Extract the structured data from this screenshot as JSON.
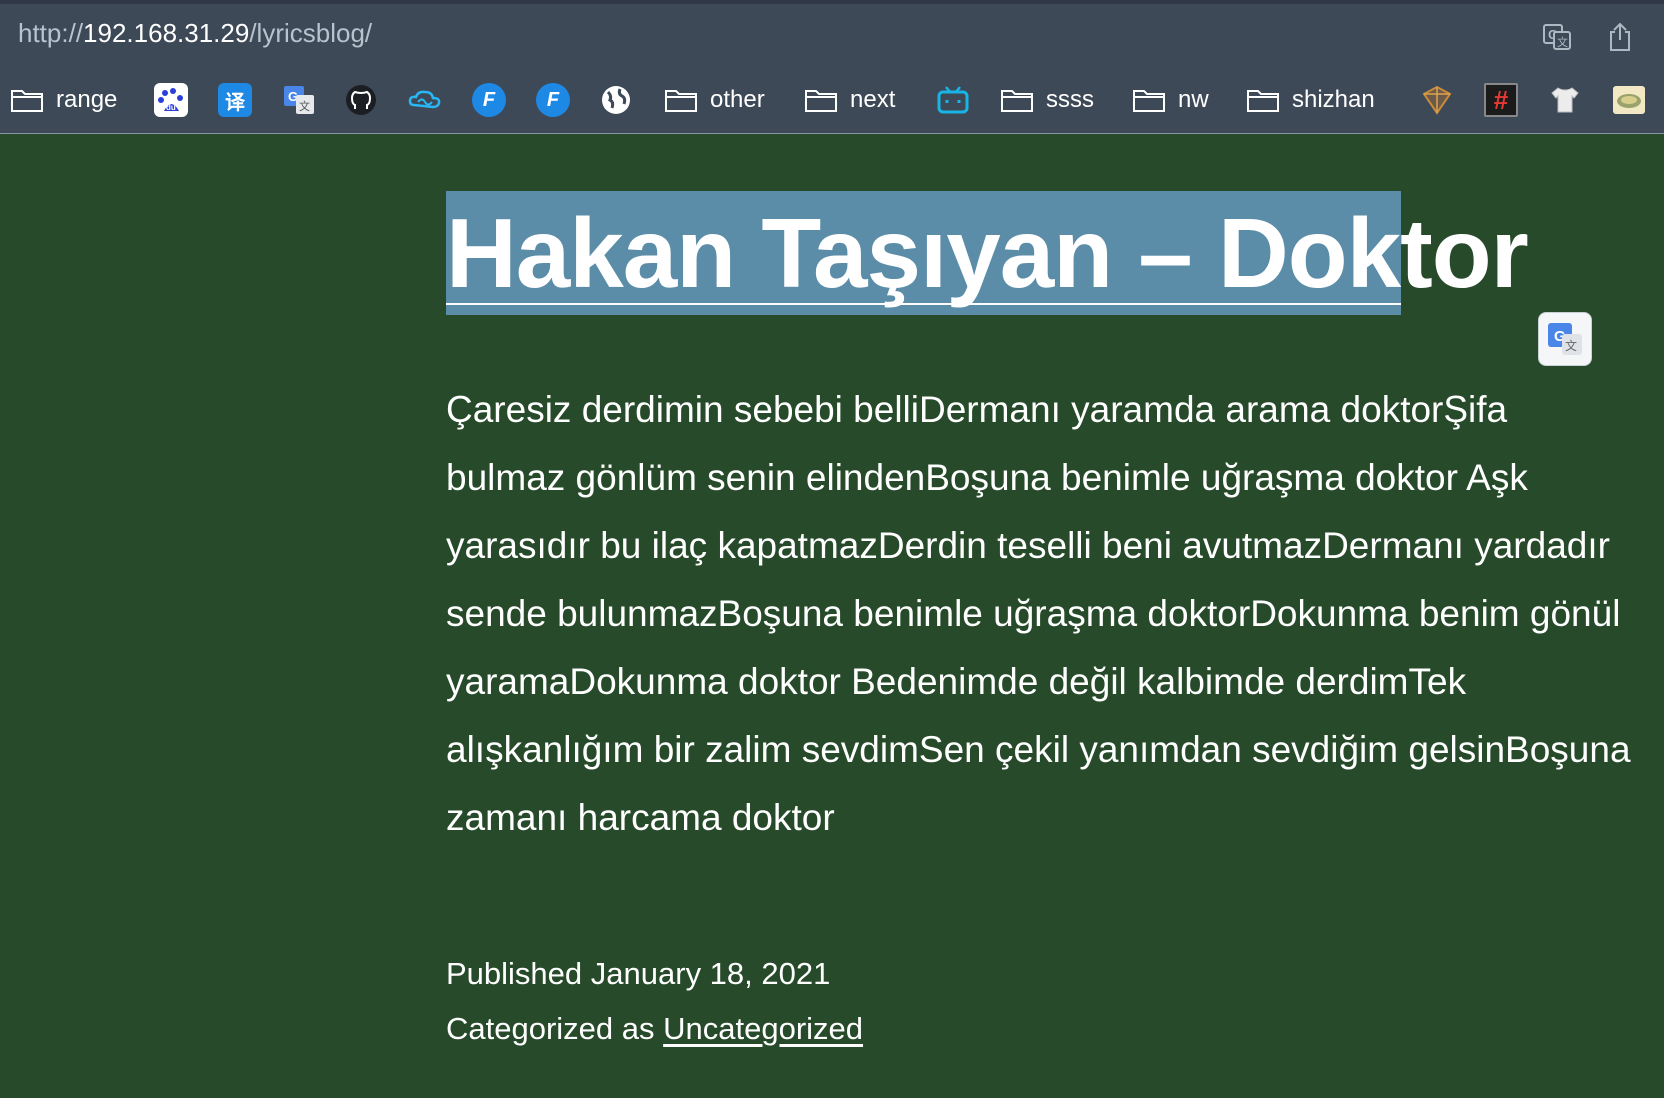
{
  "browser": {
    "url_scheme": "http://",
    "url_host": "192.168.31.29",
    "url_path": "/lyricsblog/",
    "translate_icon": "translate-icon",
    "share_icon": "share-icon"
  },
  "bookmarks": [
    {
      "type": "folder",
      "label": "range",
      "icon": "folder-icon"
    },
    {
      "type": "site",
      "icon": "baidu-icon",
      "glyph": "du"
    },
    {
      "type": "site",
      "icon": "translate-yi-icon",
      "glyph": "译"
    },
    {
      "type": "site",
      "icon": "google-translate-icon",
      "glyph": "G"
    },
    {
      "type": "site",
      "icon": "github-icon",
      "glyph": ""
    },
    {
      "type": "site",
      "icon": "cloud-icon",
      "glyph": "∞"
    },
    {
      "type": "site",
      "icon": "f-logo-icon",
      "glyph": "F"
    },
    {
      "type": "site",
      "icon": "f-logo-icon-2",
      "glyph": "F"
    },
    {
      "type": "site",
      "icon": "globe-icon",
      "glyph": ""
    },
    {
      "type": "folder",
      "label": "other",
      "icon": "folder-icon"
    },
    {
      "type": "folder",
      "label": "next",
      "icon": "folder-icon"
    },
    {
      "type": "site",
      "icon": "bilibili-icon",
      "glyph": ""
    },
    {
      "type": "folder",
      "label": "ssss",
      "icon": "folder-icon"
    },
    {
      "type": "folder",
      "label": "nw",
      "icon": "folder-icon"
    },
    {
      "type": "folder",
      "label": "shizhan",
      "icon": "folder-icon"
    },
    {
      "type": "site",
      "icon": "cube-icon",
      "glyph": ""
    },
    {
      "type": "site",
      "icon": "hash-icon",
      "glyph": "#"
    },
    {
      "type": "site",
      "icon": "shirt-icon",
      "glyph": ""
    },
    {
      "type": "site",
      "icon": "image-thumb-icon",
      "glyph": ""
    }
  ],
  "post": {
    "title": "Hakan Taşıyan – Doktor",
    "lyrics": "Çaresiz derdimin sebebi belliDermanı yaramda arama doktorŞifa bulmaz gönlüm senin elindenBoşuna benimle uğraşma doktor Aşk yarasıdır bu ilaç kapatmazDerdin teselli beni avutmazDermanı yardadır sende bulunmazBoşuna benimle uğraşma doktorDokunma benim gönül yaramaDokunma doktor Bedenimde değil kalbimde derdimTek alışkanlığım bir zalim sevdimSen çekil yanımdan sevdiğim gelsinBoşuna zamanı harcama doktor",
    "published_label": "Published",
    "published_date": "January 18, 2021",
    "categorized_label": "Categorized as",
    "category": "Uncategorized"
  },
  "colors": {
    "page_bg": "#274b2a",
    "toolbar_bg": "#3d4957",
    "title_highlight": "#5b8da9"
  }
}
